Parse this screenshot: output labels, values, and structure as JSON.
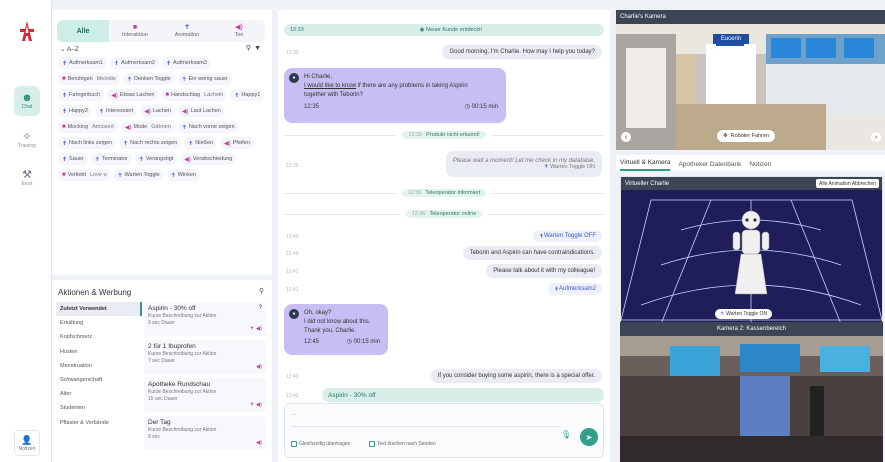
{
  "nav": {
    "items": [
      {
        "label": "Chat",
        "icon": "robot-icon",
        "active": true
      },
      {
        "label": "Training",
        "icon": "magic-wand-icon",
        "active": false
      },
      {
        "label": "Einst",
        "icon": "wrench-icon",
        "active": false
      }
    ],
    "notizen_label": "Notizen"
  },
  "library": {
    "tabs": [
      {
        "label": "Alle",
        "active": true
      },
      {
        "label": "Interaktion",
        "active": false
      },
      {
        "label": "Animation",
        "active": false
      },
      {
        "label": "Ton",
        "active": false
      }
    ],
    "sort_label": "A–Z",
    "chips": [
      {
        "label": "Aufmerksam1",
        "kind": "animation"
      },
      {
        "label": "Aufmerksam2",
        "kind": "animation"
      },
      {
        "label": "Aufmerksam3",
        "kind": "animation"
      },
      {
        "label": "Beruhigen",
        "kind": "interaction",
        "extra": "Melodie"
      },
      {
        "label": "Denken Toggle",
        "kind": "animation"
      },
      {
        "label": "Ein wenig sauer",
        "kind": "animation"
      },
      {
        "label": "Fahrgerbuch",
        "kind": "animation"
      },
      {
        "label": "Etwas Lachen",
        "kind": "sound"
      },
      {
        "label": "Handschlag",
        "kind": "interaction",
        "extra": "Lächeln"
      },
      {
        "label": "Happy1",
        "kind": "animation"
      },
      {
        "label": "Happy2",
        "kind": "animation"
      },
      {
        "label": "Interessiert",
        "kind": "animation"
      },
      {
        "label": "Lachen",
        "kind": "sound"
      },
      {
        "label": "Laut Lachen",
        "kind": "sound"
      },
      {
        "label": "Mocking",
        "kind": "interaction",
        "extra": "Amüsiert"
      },
      {
        "label": "Mode",
        "kind": "sound",
        "extra": "Gähnen"
      },
      {
        "label": "Nach vorne zeigen",
        "kind": "animation"
      },
      {
        "label": "Nach links zeigen",
        "kind": "animation"
      },
      {
        "label": "Nach rechts zeigen",
        "kind": "animation"
      },
      {
        "label": "Nießen",
        "kind": "animation"
      },
      {
        "label": "Pfeifen",
        "kind": "sound"
      },
      {
        "label": "Sauer",
        "kind": "animation"
      },
      {
        "label": "Terminator",
        "kind": "animation"
      },
      {
        "label": "Verängstigt",
        "kind": "animation"
      },
      {
        "label": "Verabschiedung",
        "kind": "sound"
      },
      {
        "label": "Verliebt",
        "kind": "interaction",
        "extra": "Love u"
      },
      {
        "label": "Warten Toggle",
        "kind": "animation"
      },
      {
        "label": "Winken",
        "kind": "animation"
      }
    ]
  },
  "actions": {
    "title": "Aktionen & Werbung",
    "categories": [
      {
        "label": "Zuletzt Verwendet",
        "active": true
      },
      {
        "label": "Erkältung"
      },
      {
        "label": "Kopfschmerz"
      },
      {
        "label": "Husten"
      },
      {
        "label": "Menstruation"
      },
      {
        "label": "Schwangerschaft"
      },
      {
        "label": "Alter"
      },
      {
        "label": "Studenten"
      },
      {
        "label": "Pflaster & Verbände"
      }
    ],
    "cards": [
      {
        "title": "Aspirin - 30% off",
        "desc": "Kurze Beschreibung zur Aktion",
        "duration": "9 sec Dauer",
        "corner": "?",
        "icons": "✝ ◀)"
      },
      {
        "title": "2 für 1 Ibuprofen",
        "desc": "Kurze Beschreibung zur Aktion",
        "duration": "7 sec Dauer",
        "corner": "",
        "icons": "◀)"
      },
      {
        "title": "Apotheke Rundschau",
        "desc": "Kurze Beschreibung zur Aktion",
        "duration": "15 sec Dauer",
        "corner": "",
        "icons": "✝ ◀)"
      },
      {
        "title": "Der Tag",
        "desc": "Kurze Beschreibung zur Aktion",
        "duration": "9 sec",
        "corner": "",
        "icons": "◀)"
      }
    ]
  },
  "chat": {
    "banner": {
      "time": "12:33",
      "text": "Neuer Kunde entdeckt!"
    },
    "greeting_out": "Good morning, I'm Charlie. How may I help you today?",
    "msg1": {
      "l1": "Hi Charlie,",
      "l2a": "I would like to know",
      "l2b": " if there are any problems in taking Aspirin",
      "l3": "together with Teborin?",
      "time": "12:35",
      "duration": "00:15 min"
    },
    "sys1": {
      "time": "12:35",
      "text": "Produkt nicht erkannt!"
    },
    "wait_msg": "Please wait a moment! Let me check in my database.",
    "wait_sub": "Warten Toggle ON",
    "sys2": {
      "time": "12:36",
      "text": "Teleoperator informiert"
    },
    "sys3": {
      "time": "12:36",
      "text": "Teleoperator online"
    },
    "toggle_off": "Warten Toggle OFF",
    "contra": "Teborin and Aspirin can have contraindications.",
    "colleague": "Please talk about it with my colleague!",
    "aufm": "Aufmerksam2",
    "msg2": {
      "l1": "Oh, okay?",
      "l2": "I did not know about this.",
      "l3": "Thank you, Charlie.",
      "time": "12:45",
      "duration": "00:15 min"
    },
    "consider": "If you consider buying some aspirin, there is a special offer.",
    "offer": "Aspirin - 30% off",
    "timestamps": [
      "12:33",
      "12:35",
      "12:40",
      "12:40",
      "12:41",
      "12:41",
      "12:43",
      "12:43"
    ],
    "input_placeholder": "...",
    "cb1": "Gleichzeitig übertragen",
    "cb2": "Text löschen nach Senden"
  },
  "right": {
    "cam1_title": "Charlie's Kamera",
    "drive_button": "Roboter Fahren",
    "tabs": [
      {
        "label": "Virtuell & Kamera",
        "active": true
      },
      {
        "label": "Apotheker Datenbank",
        "active": false
      },
      {
        "label": "Notizen",
        "active": false
      }
    ],
    "virtual_title": "Virtueller Charlie",
    "abort_button": "Alle Animation Abbrechen",
    "virtual_toggle": "Warten Toggle ON",
    "cam2_title": "Kamera 2: Kassenbereich",
    "store_sign": "Eucerin"
  },
  "colors": {
    "accent": "#35a089",
    "bubble": "#c9bef3",
    "dark": "#3b4554"
  }
}
